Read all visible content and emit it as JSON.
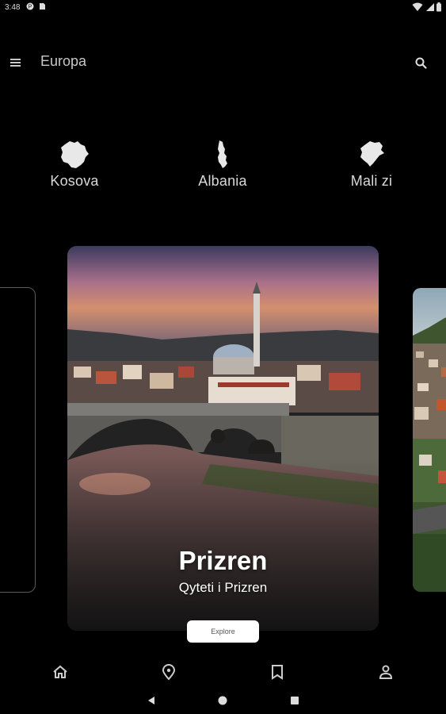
{
  "status_bar": {
    "time": "3:48"
  },
  "app_bar": {
    "title": "Europa",
    "menu_icon": "menu-icon",
    "search_icon": "search-icon"
  },
  "countries": [
    {
      "label": "Kosova",
      "icon": "kosovo-map-icon"
    },
    {
      "label": "Albania",
      "icon": "albania-map-icon"
    },
    {
      "label": "Mali zi",
      "icon": "montenegro-map-icon"
    }
  ],
  "featured_card": {
    "title": "Prizren",
    "subtitle": "Qyteti i Prizren",
    "button_label": "Explore"
  },
  "bottom_nav": [
    "home-icon",
    "location-icon",
    "bookmark-icon",
    "profile-icon"
  ],
  "system_nav": [
    "back-icon",
    "home-circle-icon",
    "recents-icon"
  ]
}
